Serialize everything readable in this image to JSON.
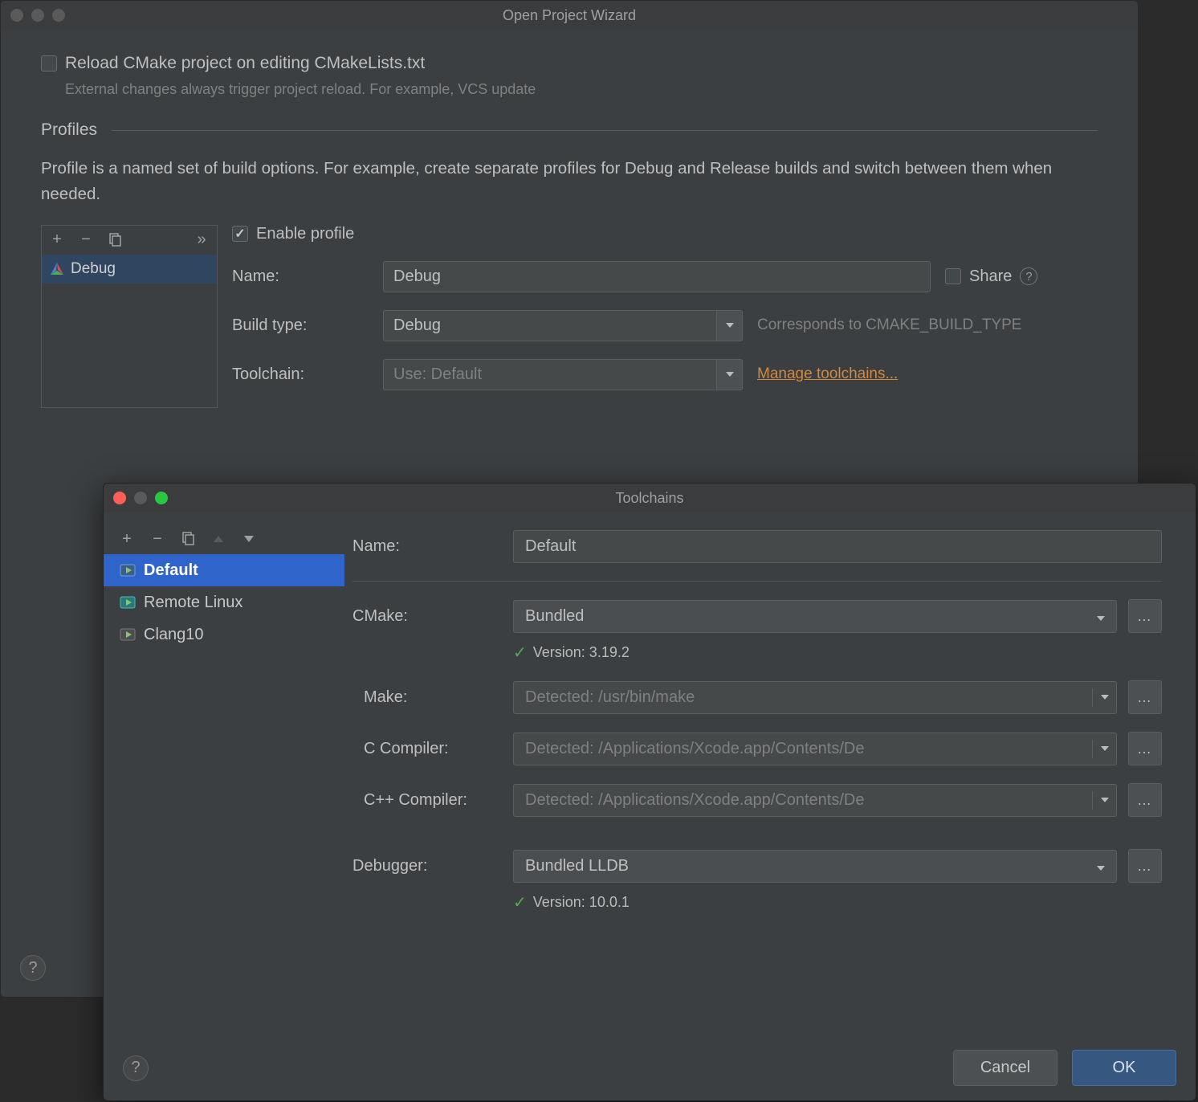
{
  "wizard": {
    "title": "Open Project Wizard",
    "reload_label": "Reload CMake project on editing CMakeLists.txt",
    "reload_hint": "External changes always trigger project reload. For example, VCS update",
    "profiles_header": "Profiles",
    "profiles_desc": "Profile is a named set of build options. For example, create separate profiles for Debug and Release builds and switch between them when needed.",
    "profile_items": [
      "Debug"
    ],
    "enable_profile_label": "Enable profile",
    "name_label": "Name:",
    "name_value": "Debug",
    "share_label": "Share",
    "build_type_label": "Build type:",
    "build_type_value": "Debug",
    "build_type_hint": "Corresponds to CMAKE_BUILD_TYPE",
    "toolchain_label": "Toolchain:",
    "toolchain_value": "Use: Default",
    "manage_link": "Manage toolchains..."
  },
  "toolchains": {
    "title": "Toolchains",
    "items": [
      {
        "name": "Default",
        "selected": true,
        "icon": "run"
      },
      {
        "name": "Remote Linux",
        "selected": false,
        "icon": "remote"
      },
      {
        "name": "Clang10",
        "selected": false,
        "icon": "run"
      }
    ],
    "name_label": "Name:",
    "name_value": "Default",
    "cmake_label": "CMake:",
    "cmake_value": "Bundled",
    "cmake_version": "Version: 3.19.2",
    "make_label": "Make:",
    "make_value": "Detected: /usr/bin/make",
    "ccomp_label": "C Compiler:",
    "ccomp_value": "Detected: /Applications/Xcode.app/Contents/De",
    "cxxcomp_label": "C++ Compiler:",
    "cxxcomp_value": "Detected: /Applications/Xcode.app/Contents/De",
    "debugger_label": "Debugger:",
    "debugger_value": "Bundled LLDB",
    "debugger_version": "Version: 10.0.1",
    "cancel": "Cancel",
    "ok": "OK"
  }
}
